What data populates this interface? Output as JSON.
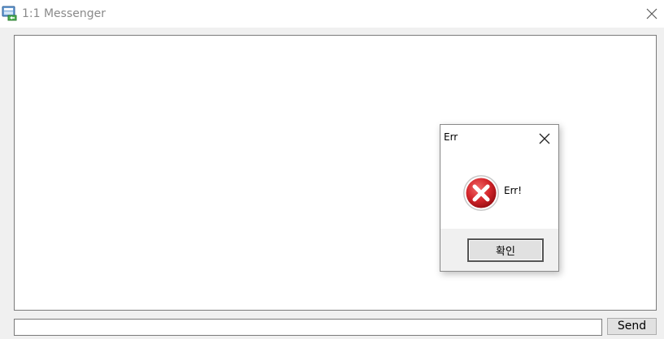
{
  "window": {
    "title": "1:1 Messenger",
    "icon": "messenger-app-icon",
    "close_icon": "close-icon"
  },
  "chat": {
    "messages": []
  },
  "composer": {
    "input_value": "",
    "send_label": "Send"
  },
  "dialog": {
    "title": "Err",
    "message": "Err!",
    "ok_label": "확인",
    "icon": "error-icon",
    "close_icon": "close-icon"
  },
  "colors": {
    "error_red": "#d4262b",
    "button_face": "#e1e1e1",
    "window_bg": "#f0f0f0"
  }
}
